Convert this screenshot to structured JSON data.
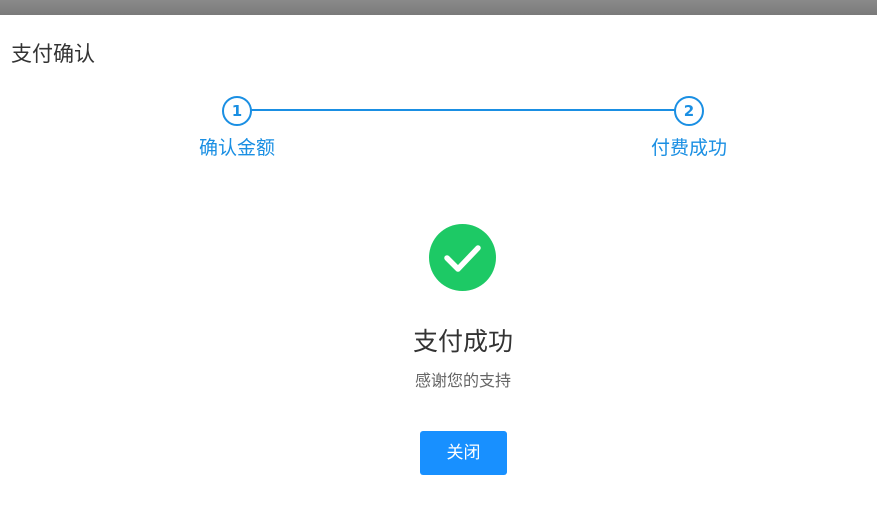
{
  "dialog": {
    "title": "支付确认"
  },
  "steps": [
    {
      "number": "1",
      "label": "确认金额"
    },
    {
      "number": "2",
      "label": "付费成功"
    }
  ],
  "result": {
    "icon": "check-circle-icon",
    "title": "支付成功",
    "subtitle": "感谢您的支持"
  },
  "actions": {
    "close_label": "关闭"
  },
  "colors": {
    "accent": "#1a8fe3",
    "success": "#1dc965",
    "button": "#1890ff"
  }
}
